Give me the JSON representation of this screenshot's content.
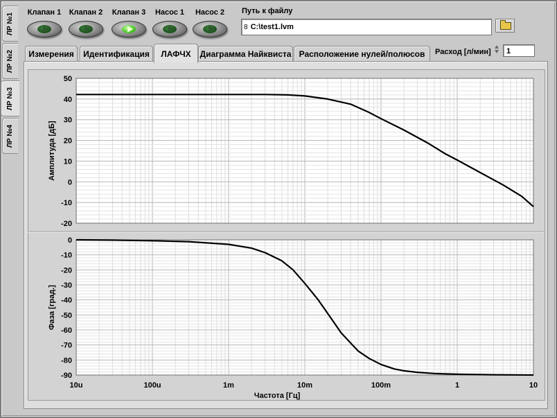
{
  "side_tabs": [
    {
      "label": "ЛР №1",
      "active": false
    },
    {
      "label": "ЛР №2",
      "active": false
    },
    {
      "label": "ЛР №3",
      "active": true
    },
    {
      "label": "ЛР №4",
      "active": false
    }
  ],
  "indicators": [
    {
      "label": "Клапан 1",
      "on": false
    },
    {
      "label": "Клапан 2",
      "on": false
    },
    {
      "label": "Клапан 3",
      "on": true
    },
    {
      "label": "Насос 1",
      "on": false
    },
    {
      "label": "Насос 2",
      "on": false
    }
  ],
  "file_path": {
    "label": "Путь к файлу",
    "prefix": "8",
    "value": "C:\\test1.lvm"
  },
  "tabs": [
    {
      "label": "Измерения",
      "active": false
    },
    {
      "label": "Идентификация",
      "active": false
    },
    {
      "label": "ЛАФЧХ",
      "active": true
    },
    {
      "label": "Диаграмма Найквиста",
      "active": false
    },
    {
      "label": "Расположение нулей/полюсов",
      "active": false
    }
  ],
  "flow": {
    "label": "Расход [л/мин]",
    "value": "1"
  },
  "chart_data": [
    {
      "type": "line",
      "name": "amplitude",
      "ylabel": "Амплитуда [дБ]",
      "xlabel": "",
      "x_scale": "log",
      "xlim": [
        1e-05,
        10
      ],
      "ylim": [
        -20,
        50
      ],
      "y_ticks": [
        "50",
        "40",
        "30",
        "20",
        "10",
        "0",
        "-10",
        "-20"
      ],
      "grid": true,
      "x": [
        1e-05,
        0.0001,
        0.001,
        0.003,
        0.006,
        0.01,
        0.02,
        0.04,
        0.07,
        0.1,
        0.2,
        0.4,
        0.7,
        1,
        2,
        4,
        7,
        10
      ],
      "y": [
        42.2,
        42.2,
        42.2,
        42.2,
        42.0,
        41.5,
        40.0,
        37.5,
        33.5,
        30.5,
        25.0,
        19.0,
        13.5,
        10.5,
        4.5,
        -1.5,
        -7.0,
        -12.0
      ]
    },
    {
      "type": "line",
      "name": "phase",
      "ylabel": "Фаза [град.]",
      "xlabel": "Частота [Гц]",
      "x_scale": "log",
      "xlim": [
        1e-05,
        10
      ],
      "ylim": [
        -90,
        0
      ],
      "x_ticks": [
        "10u",
        "100u",
        "1m",
        "10m",
        "100m",
        "1",
        "10"
      ],
      "y_ticks": [
        "0",
        "-10",
        "-20",
        "-30",
        "-40",
        "-50",
        "-60",
        "-70",
        "-80",
        "-90"
      ],
      "grid": true,
      "x": [
        1e-05,
        3e-05,
        0.0001,
        0.0003,
        0.001,
        0.002,
        0.003,
        0.005,
        0.007,
        0.01,
        0.015,
        0.02,
        0.03,
        0.05,
        0.07,
        0.1,
        0.15,
        0.2,
        0.3,
        0.5,
        1,
        3,
        10
      ],
      "y": [
        0,
        -0.2,
        -0.6,
        -1.2,
        -3.0,
        -5.5,
        -8.5,
        -14,
        -20,
        -29,
        -40,
        -49,
        -62,
        -74,
        -79,
        -83,
        -86,
        -87.2,
        -88.2,
        -89,
        -89.5,
        -89.8,
        -90
      ]
    }
  ]
}
